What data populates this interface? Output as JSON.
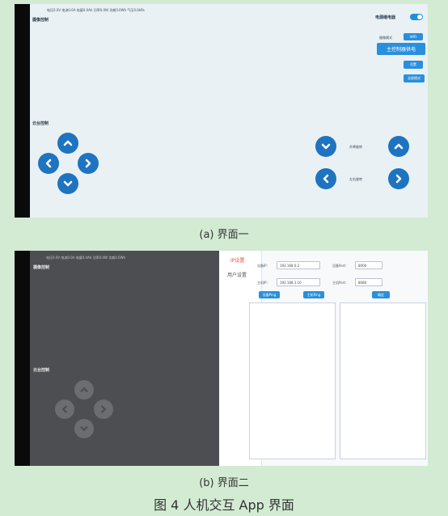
{
  "screen_a": {
    "status_line": "电压0.0V  电流0.0A  电量0.0Ah  功率0.0W  功耗0.0Wh  气压0.0kPa",
    "section1_title": "摄像控制",
    "section2_title": "云台控制",
    "power_label": "电源继电器",
    "power_toggle_on": true,
    "mode_label": "摄像模式",
    "mode_value": "WIFI",
    "main_button": "主控制器供电",
    "btn_settings": "设置",
    "btn_fullscreen": "全屏模式",
    "tilt_label": "升降旋转",
    "pan_label": "左右旋转"
  },
  "caption_a": "(a)  界面一",
  "screen_b": {
    "status_line": "电压0.0V  电流0.0A  电量0.0Ah  功率0.0W  功耗0.0Wh",
    "section1_title": "摄像控制",
    "section2_title": "云台控制",
    "menu": [
      {
        "label": "IP设置",
        "active": true
      },
      {
        "label": "用户设置",
        "active": false
      }
    ],
    "fields": {
      "ip1_label": "设备IP:",
      "ip1_value": "192.168.0.2",
      "port1_label": "设备Port:",
      "port1_value": "8000",
      "ip2_label": "主机IP:",
      "ip2_value": "192.168.1.10",
      "port2_label": "主机Port:",
      "port2_value": "8080"
    },
    "buttons": {
      "ping1": "设备Ping",
      "ping2": "主机Ping",
      "confirm": "确定"
    }
  },
  "caption_b": "(b)  界面二",
  "figure_caption": "图 4    人机交互 App 界面",
  "colors": {
    "accent": "#2a8fdc",
    "arrow": "#1e74c0",
    "background": "#d3ead3",
    "screen": "#e9f1f4",
    "dark_overlay": "#4d4e52"
  }
}
